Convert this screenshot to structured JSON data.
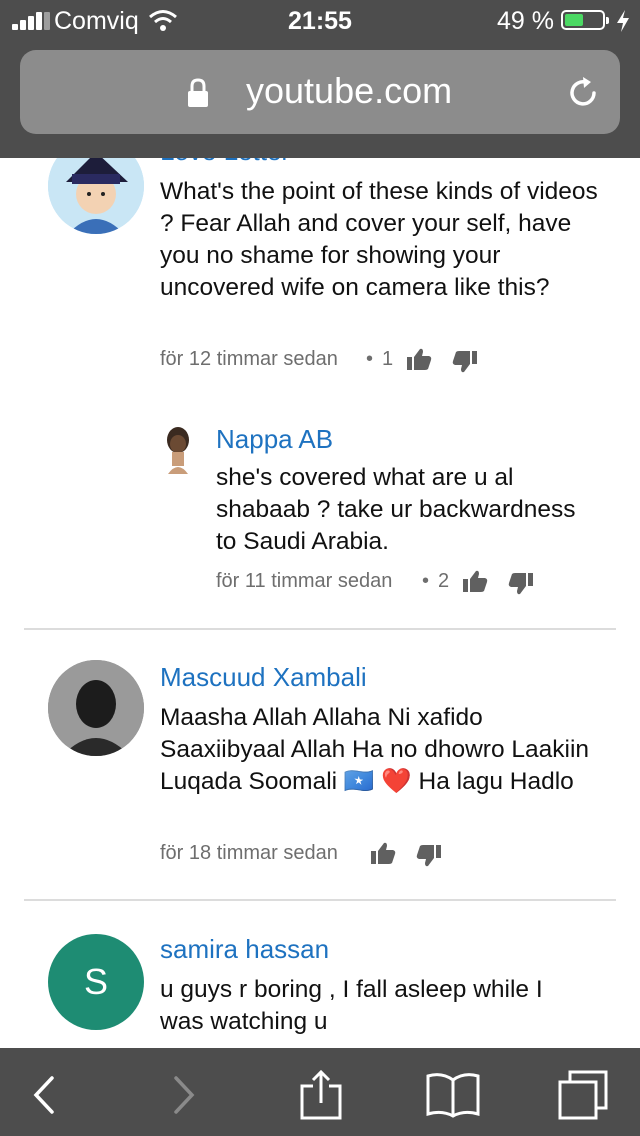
{
  "status_bar": {
    "carrier": "Comviq",
    "time": "21:55",
    "battery_percent": "49 %",
    "battery_level": 0.49,
    "battery_color": "#4cd964"
  },
  "browser": {
    "url": "youtube.com",
    "lock_icon": "lock-icon",
    "reload_icon": "reload-icon"
  },
  "comments": [
    {
      "author": "Love Letter",
      "text": "What's the point of these kinds of videos ?  Fear Allah and cover your self, have you no shame for showing your uncovered  wife on camera like this?",
      "time": "för 12 timmar sedan",
      "likes": "1"
    },
    {
      "author": "Nappa AB",
      "text": "she's covered what are u al shabaab ? take ur backwardness to Saudi Arabia.",
      "time": "för 11 timmar sedan",
      "likes": "2"
    },
    {
      "author": "Mascuud Xambali",
      "text": "Maasha Allah Allaha Ni xafido Saaxiibyaal Allah Ha no dhowro Laakiin Luqada Soomali 🇸🇴 ❤️ Ha lagu Hadlo",
      "time": "för 18 timmar sedan",
      "likes": ""
    },
    {
      "author": "samira hassan",
      "avatar_letter": "S",
      "avatar_color": "#1e8c73",
      "text": "u guys r boring , I fall asleep while I was watching u",
      "time": "",
      "likes": ""
    }
  ],
  "toolbar": {
    "items": [
      "back-icon",
      "forward-icon",
      "share-icon",
      "bookmarks-icon",
      "tabs-icon"
    ]
  },
  "colors": {
    "author_link": "#1e72c0",
    "browser_chrome": "#4d4d4d"
  }
}
